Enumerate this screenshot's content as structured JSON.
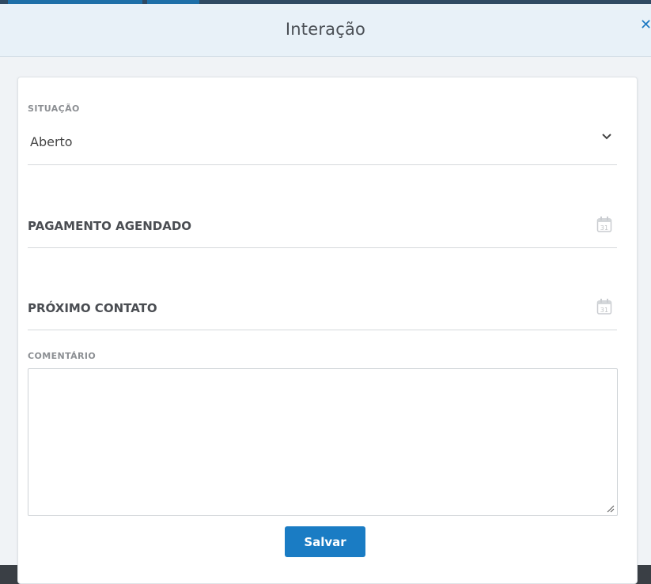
{
  "modal": {
    "title": "Interação"
  },
  "form": {
    "situacao": {
      "label": "SITUAÇÃO",
      "value": "Aberto"
    },
    "pagamento_agendado": {
      "label": "PAGAMENTO AGENDADO"
    },
    "proximo_contato": {
      "label": "PRÓXIMO CONTATO"
    },
    "comentario": {
      "label": "COMENTÁRIO",
      "value": ""
    },
    "save_label": "Salvar"
  },
  "icons": {
    "close": "close-icon",
    "dropdown": "chevron-down-icon",
    "calendar": "calendar-icon",
    "resize": "resize-handle-icon"
  },
  "colors": {
    "accent": "#1a7cc4",
    "header_bg": "#e8f1f8",
    "close": "#1b78c2"
  }
}
